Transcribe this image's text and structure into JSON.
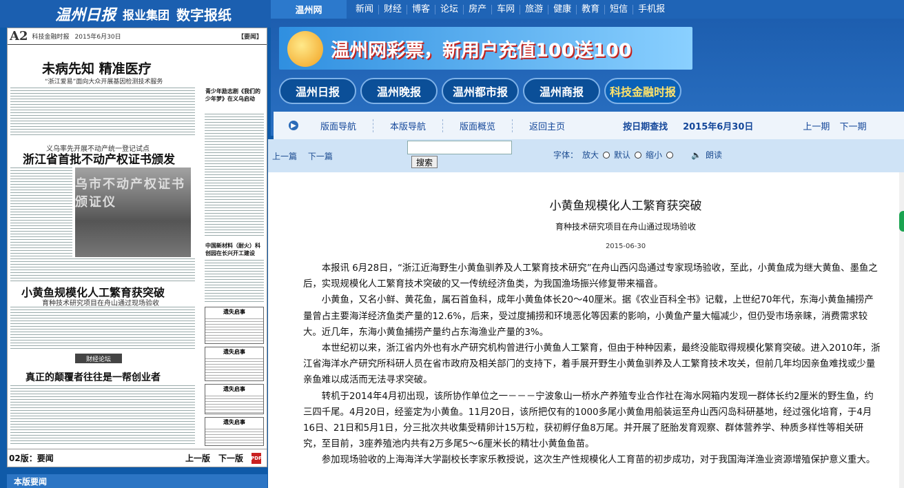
{
  "left_header": {
    "logo": "温州日报",
    "group": "报业集团",
    "digital": "数字报纸"
  },
  "topnav": {
    "site": "温州网",
    "items": [
      "新闻",
      "财经",
      "博客",
      "论坛",
      "房产",
      "车网",
      "旅游",
      "健康",
      "教育",
      "短信",
      "手机报"
    ]
  },
  "banner": {
    "lottery_text": "温州网彩票，新用户充值100送100"
  },
  "papers": [
    "温州日报",
    "温州晚报",
    "温州都市报",
    "温州商报",
    "科技金融时报"
  ],
  "subnav": {
    "links": [
      "版面导航",
      "本版导航",
      "版面概览",
      "返回主页"
    ],
    "date_query": "按日期查找",
    "date": "2015年6月30日",
    "prev_issue": "上一期",
    "next_issue": "下一期"
  },
  "toolbar": {
    "prev_article": "上一篇",
    "next_article": "下一篇",
    "search_button": "搜索",
    "font_label": "字体：",
    "font_large": "放大",
    "font_default": "默认",
    "font_small": "缩小",
    "read_aloud": "朗读"
  },
  "newspaper": {
    "page_no": "A2",
    "paper_name": "科技金融时报",
    "page_date": "2015年6月30日",
    "section": "【要闻】",
    "headline1": "未病先知  精准医疗",
    "sub1": "“浙江爱易”面向大众开展基因检测技术服务",
    "sub2": "义乌率先开展不动产统一登记试点",
    "headline2": "浙江省首批不动产权证书颁发",
    "photo_sign": "乌市不动产权证书颁证仪",
    "headline3": "小黄鱼规模化人工繁育获突破",
    "sub3": "育种技术研究项目在舟山通过现场验收",
    "column_tag": "财经论坛",
    "headline4": "真正的颠覆者往往是一帮创业者",
    "side1": "青少年励志剧《我们的少年梦》在义乌启动",
    "side2": "中国新材料（耐火）科创园在长兴开工建设",
    "ad_title": "遗失启事",
    "footer_section": "02版：要闻",
    "footer_prev": "上一版",
    "footer_next": "下一版",
    "pdf": "PDF"
  },
  "bottom_bar": "本版要闻",
  "article": {
    "title": "小黄鱼规模化人工繁育获突破",
    "subtitle": "育种技术研究项目在舟山通过现场验收",
    "date": "2015-06-30",
    "paragraphs": [
      "本报讯 6月28日，“浙江近海野生小黄鱼驯养及人工繁育技术研究”在舟山西闪岛通过专家现场验收，至此，小黄鱼成为继大黄鱼、墨鱼之后，实现规模化人工繁育技术突破的又一传统经济鱼类，为我国渔场振兴修复带来福音。",
      "小黄鱼，又名小鲜、黄花鱼，属石首鱼科，成年小黄鱼体长20～40厘米。据《农业百科全书》记载，上世纪70年代，东海小黄鱼捕捞产量曾占主要海洋经济鱼类产量的12.6%，后来，受过度捕捞和环境恶化等因素的影响，小黄鱼产量大幅减少，但仍受市场亲睐，消费需求较大。近几年，东海小黄鱼捕捞产量约占东海渔业产量的3%。",
      "本世纪初以来，浙江省内外也有水产研究机构曾进行小黄鱼人工繁育，但由于种种因素，最终没能取得规模化繁育突破。进入2010年，浙江省海洋水产研究所科研人员在省市政府及相关部门的支持下，着手展开野生小黄鱼驯养及人工繁育技术攻关，但前几年均因亲鱼难找或少量亲鱼难以成活而无法寻求突破。",
      "转机于2014年4月初出现，该所协作单位之一－－－宁波象山一桥水产养殖专业合作社在海水网箱内发现一群体长约2厘米的野生鱼，约三四千尾。4月20日，经鉴定为小黄鱼。11月20日，该所把仅有的1000多尾小黄鱼用船装运至舟山西闪岛科研基地，经过强化培育，于4月16日、21日和5月1日，分三批次共收集受精卵计15万粒，获初孵仔鱼8万尾。并开展了胚胎发育观察、群体营养学、种质多样性等相关研究，至目前，3座养殖池内共有2万多尾5～6厘米长的精壮小黄鱼鱼苗。",
      "参加现场验收的上海海洋大学副校长李家乐教授说，这次生产性规模化人工育苗的初步成功，对于我国海洋渔业资源增殖保护意义重大。"
    ]
  }
}
